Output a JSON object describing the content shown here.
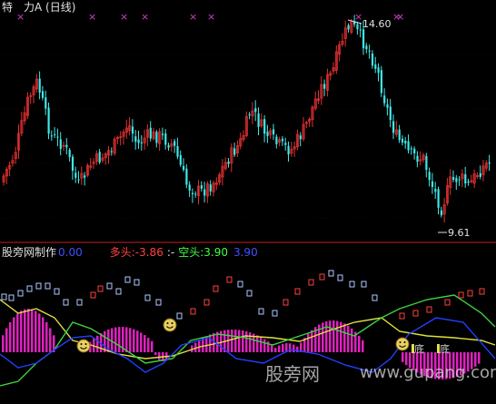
{
  "price_panel": {
    "title": "特　力A (日线)",
    "high_label": "14.60",
    "low_label": "9.61"
  },
  "indicator_panel": {
    "source": "股旁网制作",
    "source_value": "0.00",
    "long_label": "多头:",
    "long_value": "-3.86",
    "short_label": "空头:",
    "short_value": "3.90",
    "extra_value": "3.90",
    "bottom_char": "底"
  },
  "watermark": {
    "cn": "股旁网",
    "url": "www.gupang.com"
  },
  "colors": {
    "background": "#000000",
    "up_candle": "#e03030",
    "down_candle": "#40e8e8",
    "long": "#ff4040",
    "short": "#40ff40",
    "blue_line": "#2040ff",
    "green_line": "#40d040",
    "yellow_line": "#e0e040",
    "histogram": "#e020c0",
    "signal_x": "#d040d0",
    "separator": "#c02020"
  },
  "chart_data": [
    {
      "type": "candlestick",
      "title": "特　力A (日线)",
      "annotations": [
        {
          "text": "14.60",
          "kind": "period-high"
        },
        {
          "text": "9.61",
          "kind": "period-low"
        }
      ]
    },
    {
      "type": "line",
      "series": [
        {
          "name": "多头",
          "value": -3.86
        },
        {
          "name": "空头",
          "value": 3.9
        }
      ]
    }
  ]
}
